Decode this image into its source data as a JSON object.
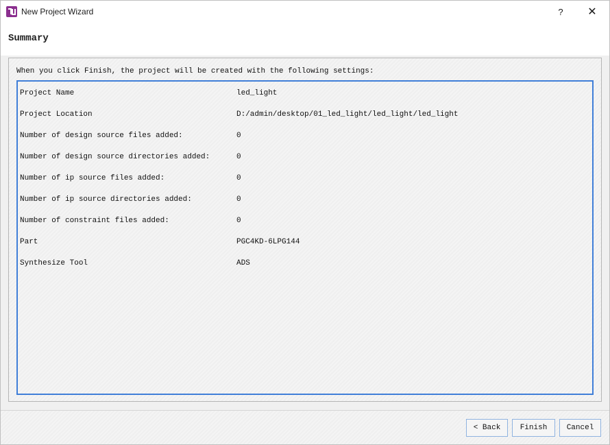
{
  "window": {
    "title": "New Project Wizard",
    "help_label": "?",
    "close_label": "✕"
  },
  "page": {
    "title": "Summary",
    "intro": "When you click Finish, the project will be created with the following settings:"
  },
  "settings": [
    {
      "key": "Project Name",
      "value": "led_light"
    },
    {
      "key": "Project Location",
      "value": "D:/admin/desktop/01_led_light/led_light/led_light"
    },
    {
      "key": "Number of design source files added:",
      "value": "0"
    },
    {
      "key": "Number of design source directories added:",
      "value": "0"
    },
    {
      "key": "Number of ip source files added:",
      "value": "0"
    },
    {
      "key": "Number of ip source directories added:",
      "value": "0"
    },
    {
      "key": "Number of constraint files added:",
      "value": "0"
    },
    {
      "key": "Part",
      "value": "PGC4KD-6LPG144"
    },
    {
      "key": "Synthesize Tool",
      "value": "ADS"
    }
  ],
  "buttons": {
    "back": "< Back",
    "finish": "Finish",
    "cancel": "Cancel"
  },
  "colors": {
    "accent": "#3f7ed8",
    "app_icon": "#8b2f8f"
  }
}
